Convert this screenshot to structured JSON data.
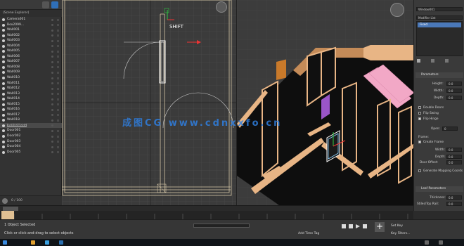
{
  "explorer": {
    "header": "(Scene Explorer)",
    "items": [
      {
        "name": "Camera001"
      },
      {
        "name": "Box2099..."
      },
      {
        "name": "Wall001"
      },
      {
        "name": "Wall002"
      },
      {
        "name": "Wall003"
      },
      {
        "name": "Wall004"
      },
      {
        "name": "Wall005"
      },
      {
        "name": "Wall006"
      },
      {
        "name": "Wall007"
      },
      {
        "name": "Wall008"
      },
      {
        "name": "Wall009"
      },
      {
        "name": "Wall010"
      },
      {
        "name": "Wall011"
      },
      {
        "name": "Wall012"
      },
      {
        "name": "Wall013"
      },
      {
        "name": "Wall014"
      },
      {
        "name": "Wall015"
      },
      {
        "name": "Wall016"
      },
      {
        "name": "Wall017"
      },
      {
        "name": "Wall018"
      },
      {
        "name": "Window001",
        "selected": true
      },
      {
        "name": "Door001"
      },
      {
        "name": "Door002"
      },
      {
        "name": "Door003"
      },
      {
        "name": "Door004"
      },
      {
        "name": "Door005"
      }
    ],
    "footer_value": "0 / 100"
  },
  "plan_viewport": {
    "shift_label": "SHIFT"
  },
  "watermark": "成图CG  www.cdnxxfo.cn",
  "panel": {
    "top_label": "Window001",
    "dropdown_label": "Modifier List",
    "stack_item": "Fixed",
    "sections": {
      "parameters": "Parameters",
      "rails": "Rails and Panels"
    },
    "fields": [
      {
        "label": "Height:",
        "value": "0.0"
      },
      {
        "label": "Width:",
        "value": "0.0"
      },
      {
        "label": "Depth:",
        "value": "0.0"
      }
    ],
    "checks": [
      {
        "label": "Double Doors"
      },
      {
        "label": "Flip Swing"
      },
      {
        "label": "Flip Hinge"
      }
    ],
    "open_label": "Open:",
    "open_value": "0",
    "frame_label": "Frame:",
    "create_frame": "Create Frame",
    "frame_fields": [
      {
        "label": "Width:",
        "value": "0.0"
      },
      {
        "label": "Depth:",
        "value": "0.0"
      },
      {
        "label": "Door Offset:",
        "value": "0.0"
      }
    ],
    "generate_mapping": "Generate Mapping Coords",
    "leaf_params": "Leaf Parameters",
    "thickness_label": "Thickness:",
    "thickness_value": "0.0",
    "stiles_label": "Stiles/Top Rail:",
    "stiles_value": "0.0"
  },
  "status": {
    "objects_selected": "1 Object Selected",
    "prompt": "Click or click-and-drag to select objects",
    "add_time_tag": "Add Time Tag",
    "set_key": "Set Key",
    "key_filters": "Key Filters..."
  },
  "colors": {
    "wall_top": "#e8b585",
    "wall_side": "#c98f5c",
    "floor": "#111111",
    "stairs": "#f2a8c6",
    "purple_door": "#9a55c8",
    "grid": "#555555",
    "accent": "#2f7fe0"
  }
}
